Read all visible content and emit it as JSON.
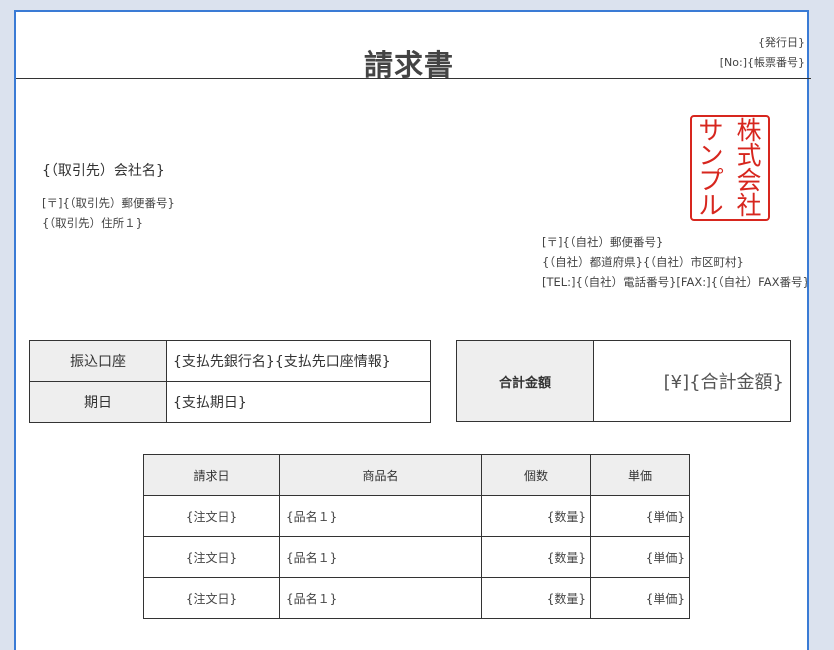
{
  "header": {
    "title": "請求書",
    "issue_date": "{発行日}",
    "doc_no": "[No:]{帳票番号}"
  },
  "client": {
    "company": "{（取引先）会社名}",
    "postal": "[〒]{（取引先）郵便番号}",
    "address1": "{（取引先）住所１}"
  },
  "seal": {
    "col_right": [
      "株",
      "式",
      "会",
      "社"
    ],
    "col_left": [
      "サ",
      "ン",
      "プ",
      "ル"
    ],
    "color": "#d7261e"
  },
  "sender": {
    "postal": "[〒]{（自社）郵便番号}",
    "address": "{（自社）都道府県}{（自社）市区町村}",
    "phone_fax": "[TEL:]{（自社）電話番号}[FAX:]{（自社）FAX番号}"
  },
  "payment": {
    "account_label": "振込口座",
    "account_value": "{支払先銀行名}{支払先口座情報}",
    "due_label": "期日",
    "due_value": "{支払期日}"
  },
  "total": {
    "label": "合計金額",
    "value": "[¥]{合計金額}"
  },
  "items": {
    "headers": [
      "請求日",
      "商品名",
      "個数",
      "単価"
    ],
    "rows": [
      [
        "{注文日}",
        "{品名１}",
        "{数量}",
        "{単価}"
      ],
      [
        "{注文日}",
        "{品名１}",
        "{数量}",
        "{単価}"
      ],
      [
        "{注文日}",
        "{品名１}",
        "{数量}",
        "{単価}"
      ]
    ]
  }
}
